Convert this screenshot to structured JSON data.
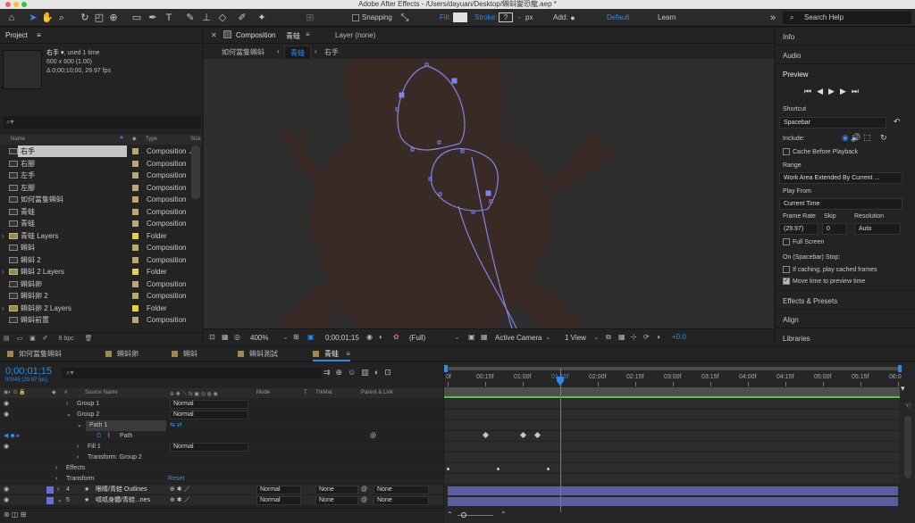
{
  "app": {
    "title": "Adobe After Effects - /Users/dayuan/Desktop/蝌蚪變恐龍.aep *"
  },
  "toolbar": {
    "snapping": "Snapping",
    "fill": "Fill:",
    "stroke": "Stroke:",
    "stroke_value": "-",
    "stroke_unit": "px",
    "add": "Add:",
    "workspace_default": "Default",
    "workspace_learn": "Learn",
    "search_placeholder": "Search Help"
  },
  "project": {
    "title": "Project",
    "selected_name": "右手 ▾",
    "used": ", used 1 time",
    "dims": "600 x 600 (1.00)",
    "duration": "Δ 0;00;10;00, 29.97 fps",
    "col_name": "Name",
    "col_type": "Type",
    "col_size": "Size",
    "bpc": "8 bpc",
    "items": [
      {
        "name": "右手",
        "type": "Composition",
        "kind": "comp",
        "color": "#b9a77a",
        "selected": true
      },
      {
        "name": "右腳",
        "type": "Composition",
        "kind": "comp",
        "color": "#b9a77a"
      },
      {
        "name": "左手",
        "type": "Composition",
        "kind": "comp",
        "color": "#b9a77a"
      },
      {
        "name": "左腳",
        "type": "Composition",
        "kind": "comp",
        "color": "#b9a77a"
      },
      {
        "name": "如何當隻蝌蚪",
        "type": "Composition",
        "kind": "comp",
        "color": "#b9a77a"
      },
      {
        "name": "青蛙",
        "type": "Composition",
        "kind": "comp",
        "color": "#b9a77a"
      },
      {
        "name": "青蛙",
        "type": "Composition",
        "kind": "comp",
        "color": "#b9a77a"
      },
      {
        "name": "青蛙 Layers",
        "type": "Folder",
        "kind": "folder",
        "color": "#e6d04a"
      },
      {
        "name": "蝌蚪",
        "type": "Composition",
        "kind": "comp",
        "color": "#b9a77a"
      },
      {
        "name": "蝌蚪 2",
        "type": "Composition",
        "kind": "comp",
        "color": "#b9a77a"
      },
      {
        "name": "蝌蚪 2 Layers",
        "type": "Folder",
        "kind": "folder",
        "color": "#e6d04a"
      },
      {
        "name": "蝌蚪卵",
        "type": "Composition",
        "kind": "comp",
        "color": "#b9a77a"
      },
      {
        "name": "蝌蚪卵 2",
        "type": "Composition",
        "kind": "comp",
        "color": "#b9a77a"
      },
      {
        "name": "蝌蚪卵 2 Layers",
        "type": "Folder",
        "kind": "folder",
        "color": "#e6d04a"
      },
      {
        "name": "蝌蚪前置",
        "type": "Composition",
        "kind": "comp",
        "color": "#b9a77a"
      }
    ]
  },
  "viewer": {
    "comp_tab": "Composition",
    "comp_name": "青蛙",
    "layer_tab": "Layer (none)",
    "crumbs": [
      "如何當隻蝌蚪",
      "青蛙",
      "右手"
    ],
    "zoom": "400%",
    "timecode": "0;00;01;15",
    "resolution": "(Full)",
    "camera": "Active Camera",
    "view": "1 View",
    "exposure": "+0.0"
  },
  "right": {
    "info": "Info",
    "audio": "Audio",
    "preview": "Preview",
    "shortcut_label": "Shortcut",
    "shortcut": "Spacebar",
    "include": "Include:",
    "cache_before": "Cache Before Playback",
    "range_label": "Range",
    "range": "Work Area Extended By Current ...",
    "play_from_label": "Play From",
    "play_from": "Current Time",
    "frame_rate_label": "Frame Rate",
    "skip_label": "Skip",
    "resolution_label": "Resolution",
    "frame_rate": "(29.97)",
    "skip": "0",
    "resolution": "Auto",
    "full_screen": "Full Screen",
    "on_stop": "On (Spacebar) Stop:",
    "if_caching": "If caching, play cached frames",
    "move_time": "Move time to preview time",
    "effects": "Effects & Presets",
    "align": "Align",
    "libraries": "Libraries"
  },
  "timeline": {
    "tabs": [
      "如何當隻蝌蚪",
      "蝌蚪卵",
      "蝌蚪",
      "蝌蚪測試",
      "青蛙"
    ],
    "timecode": "0;00;01;15",
    "frame_info": "00045 (29.97 fps)",
    "col_hash": "#",
    "col_source": "Source Name",
    "col_mode": "Mode",
    "col_t": "T",
    "col_trkmat": "TrkMat",
    "col_parent": "Parent & Link",
    "ruler": [
      "0f",
      "00:15f",
      "01:00f",
      "01:15f",
      "02:00f",
      "02:15f",
      "03:00f",
      "03:15f",
      "04:00f",
      "04:15f",
      "05:00f",
      "05:15f",
      "06:0"
    ],
    "ruler_active": "01:15f",
    "rows": {
      "group1": "Group 1",
      "group2": "Group 2",
      "path1": "Path 1",
      "path": "Path",
      "fill1": "Fill 1",
      "transform_group2": "Transform: Group 2",
      "effects": "Effects",
      "transform": "Transform",
      "reset": "Reset",
      "layer4_num": "4",
      "layer4": "眼睛/青蛙 Outlines",
      "layer5_num": "5",
      "layer5": "呱呱身體/青蛙...nes",
      "normal": "Normal",
      "none": "None"
    },
    "current_time_fraction": 0.25
  },
  "colors": {
    "accent": "#2d8ceb",
    "path": "#7f86e8",
    "layer_bar": "#5a5e9e",
    "silhouette": "#3a2a26"
  }
}
